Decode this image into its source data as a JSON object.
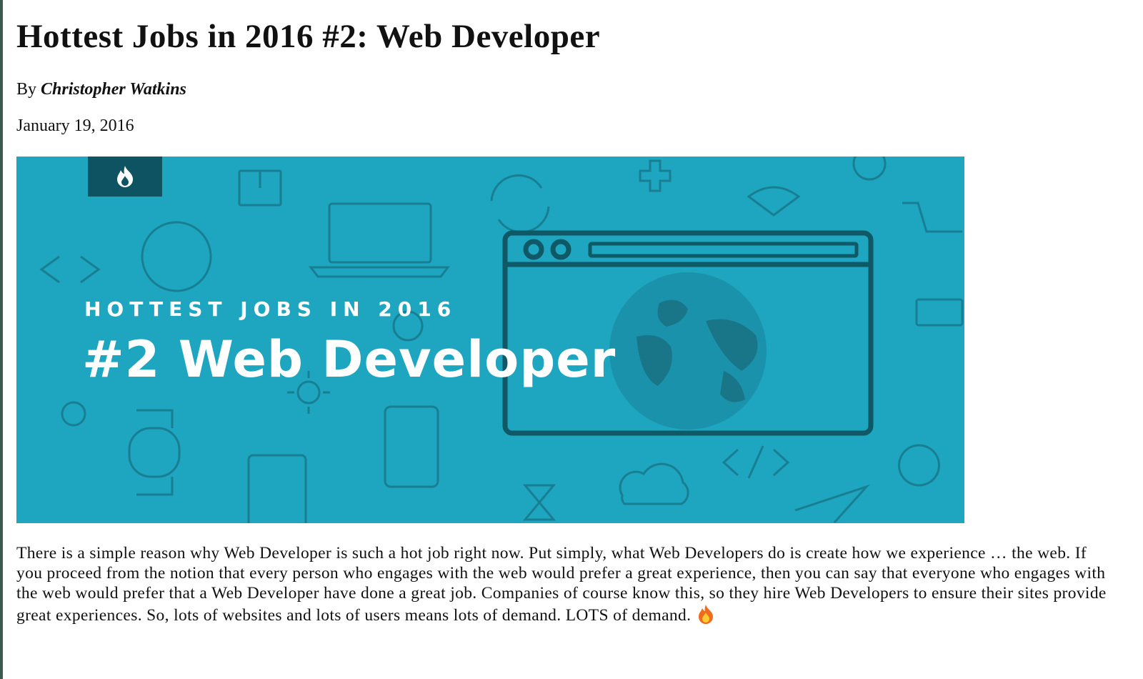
{
  "article": {
    "title": "Hottest Jobs in 2016 #2: Web Developer",
    "byline_prefix": "By",
    "author": "Christopher Watkins",
    "date": "January 19, 2016",
    "body": "There is a simple reason why Web Developer is such a hot job right now. Put simply, what Web Developers do is create how we experience … the web. If you proceed from the notion that every person who engages with the web would prefer a great experience, then you can say that everyone who engages with the web would prefer that a Web Developer have done a great job. Companies of course know this, so they hire Web Developers to ensure their sites provide great experiences. So, lots of websites and lots of users means lots of demand. LOTS of demand."
  },
  "hero": {
    "kicker": "HOTTEST JOBS IN 2016",
    "headline": "#2 Web Developer",
    "badge_icon": "flame-icon",
    "background_color": "#1ea5bf",
    "badge_color": "#0e5361",
    "line_color": "#14616f"
  },
  "icons": {
    "end_emoji": "fire-emoji-icon"
  }
}
